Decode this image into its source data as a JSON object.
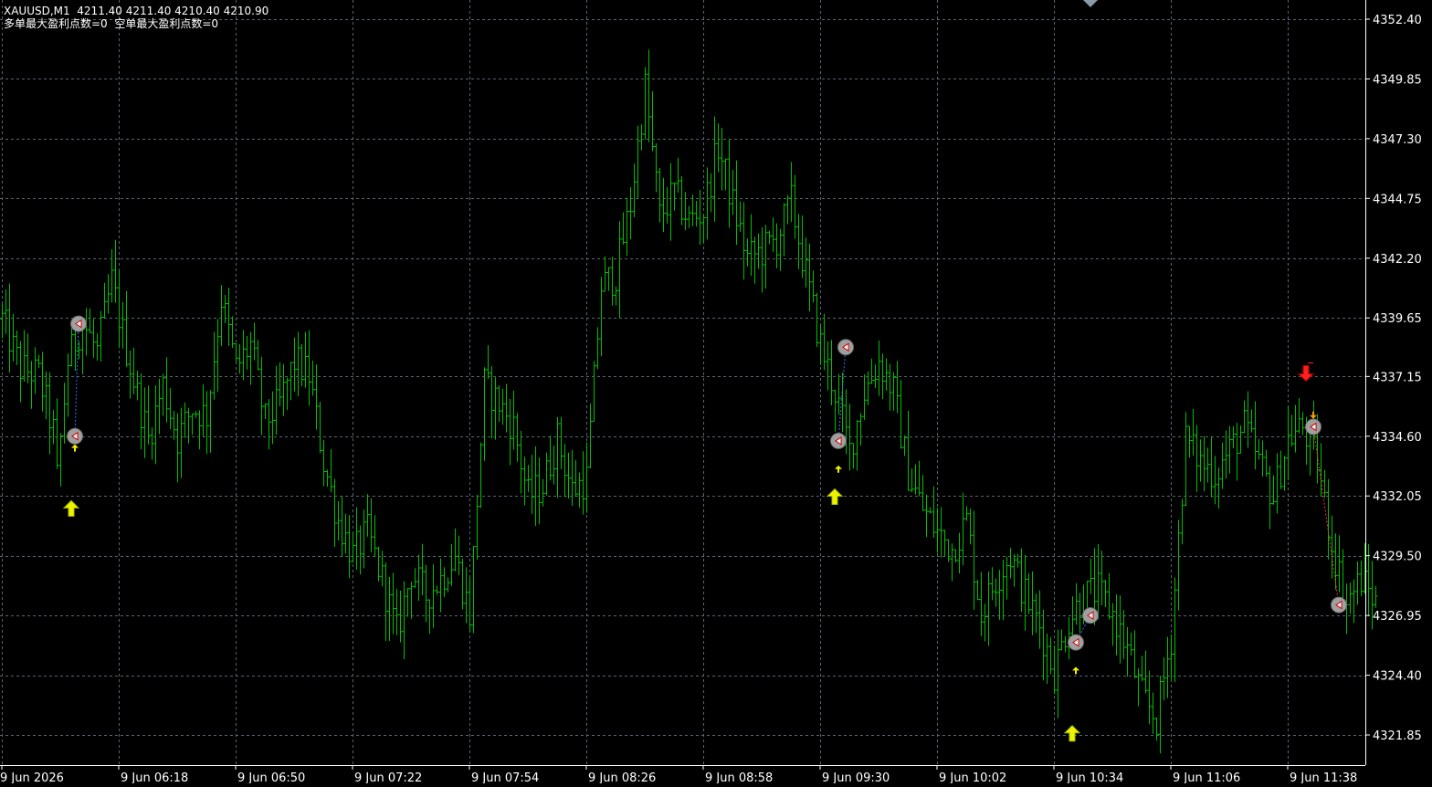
{
  "header": {
    "symbol_line": "XAUUSD,M1  4211.40 4211.40 4210.40 4210.90",
    "stats_line": "多单最大盈利点数=0  空单最大盈利点数=0"
  },
  "colors": {
    "background": "#000000",
    "grid": "#5a6473",
    "axis": "#ffffff",
    "bar": "#00c000",
    "buy_arrow": "#f0f000",
    "sell_arrow": "#ff2020",
    "marker_ring": "#a0a0a0",
    "trade_line_buy": "#1e78ff",
    "trade_line_sell": "#ff3030"
  },
  "chart_data": {
    "type": "bar",
    "symbol": "XAUUSD",
    "timeframe": "M1",
    "ylim": [
      4320.4,
      4353.35
    ],
    "y_ticks": [
      "4352.40",
      "4349.85",
      "4347.30",
      "4344.75",
      "4342.20",
      "4339.65",
      "4337.15",
      "4334.60",
      "4332.05",
      "4329.50",
      "4326.95",
      "4324.40",
      "4321.85"
    ],
    "x_ticks": [
      "9 Jun 2026",
      "9 Jun 06:18",
      "9 Jun 06:50",
      "9 Jun 07:22",
      "9 Jun 07:54",
      "9 Jun 08:26",
      "9 Jun 08:58",
      "9 Jun 09:30",
      "9 Jun 10:02",
      "9 Jun 10:34",
      "9 Jun 11:06",
      "9 Jun 11:38"
    ],
    "bars_per_x_tick": 32,
    "price_path": [
      [
        0,
        4339.6
      ],
      [
        5,
        4337.5
      ],
      [
        10,
        4337.2
      ],
      [
        14,
        4334.8
      ],
      [
        15,
        4332.8
      ],
      [
        18,
        4337.8
      ],
      [
        22,
        4339.5
      ],
      [
        26,
        4338.2
      ],
      [
        30,
        4341.2
      ],
      [
        33,
        4339.0
      ],
      [
        36,
        4337.0
      ],
      [
        40,
        4334.5
      ],
      [
        44,
        4336.8
      ],
      [
        48,
        4334.5
      ],
      [
        52,
        4335.8
      ],
      [
        56,
        4335.5
      ],
      [
        60,
        4340.5
      ],
      [
        64,
        4337.5
      ],
      [
        68,
        4338.5
      ],
      [
        72,
        4335.2
      ],
      [
        76,
        4336.0
      ],
      [
        80,
        4337.8
      ],
      [
        84,
        4337.2
      ],
      [
        88,
        4333.5
      ],
      [
        92,
        4331.0
      ],
      [
        96,
        4329.5
      ],
      [
        100,
        4330.5
      ],
      [
        104,
        4328.5
      ],
      [
        108,
        4326.2
      ],
      [
        112,
        4328.8
      ],
      [
        116,
        4327.8
      ],
      [
        120,
        4328.5
      ],
      [
        124,
        4329.5
      ],
      [
        128,
        4327.0
      ],
      [
        132,
        4336.8
      ],
      [
        136,
        4336.0
      ],
      [
        140,
        4335.0
      ],
      [
        144,
        4332.0
      ],
      [
        148,
        4332.5
      ],
      [
        152,
        4334.5
      ],
      [
        156,
        4332.3
      ],
      [
        160,
        4332.8
      ],
      [
        164,
        4341.0
      ],
      [
        168,
        4341.5
      ],
      [
        172,
        4344.5
      ],
      [
        176,
        4349.5
      ],
      [
        180,
        4344.0
      ],
      [
        184,
        4345.0
      ],
      [
        188,
        4343.8
      ],
      [
        192,
        4344.2
      ],
      [
        196,
        4347.0
      ],
      [
        200,
        4344.5
      ],
      [
        204,
        4342.2
      ],
      [
        208,
        4342.5
      ],
      [
        212,
        4343.0
      ],
      [
        216,
        4344.6
      ],
      [
        220,
        4341.5
      ],
      [
        224,
        4338.5
      ],
      [
        228,
        4336.5
      ],
      [
        232,
        4334.0
      ],
      [
        236,
        4336.5
      ],
      [
        240,
        4337.8
      ],
      [
        244,
        4336.5
      ],
      [
        248,
        4333.0
      ],
      [
        252,
        4331.5
      ],
      [
        256,
        4330.5
      ],
      [
        260,
        4329.8
      ],
      [
        264,
        4331.0
      ],
      [
        268,
        4327.0
      ],
      [
        272,
        4328.5
      ],
      [
        276,
        4329.5
      ],
      [
        280,
        4327.8
      ],
      [
        284,
        4326.5
      ],
      [
        288,
        4324.5
      ],
      [
        292,
        4326.8
      ],
      [
        296,
        4327.8
      ],
      [
        300,
        4328.0
      ],
      [
        304,
        4327.0
      ],
      [
        308,
        4325.5
      ],
      [
        312,
        4323.5
      ],
      [
        316,
        4322.5
      ],
      [
        320,
        4326.0
      ],
      [
        324,
        4334.5
      ],
      [
        328,
        4333.5
      ],
      [
        332,
        4333.0
      ],
      [
        336,
        4334.0
      ],
      [
        340,
        4335.0
      ],
      [
        344,
        4333.5
      ],
      [
        348,
        4332.0
      ],
      [
        352,
        4334.5
      ],
      [
        356,
        4335.0
      ],
      [
        360,
        4333.5
      ],
      [
        364,
        4330.0
      ],
      [
        368,
        4327.5
      ],
      [
        372,
        4328.5
      ],
      [
        376,
        4327.5
      ]
    ],
    "signals": [
      {
        "type": "buy-arrow",
        "bar": 19,
        "price": 4331.5
      },
      {
        "type": "buy-arrow",
        "bar": 228,
        "price": 4332.0
      },
      {
        "type": "buy-arrow",
        "bar": 293,
        "price": 4321.9
      },
      {
        "type": "sell-arrow",
        "bar": 357,
        "price": 4337.3
      }
    ],
    "small_arrows": [
      {
        "type": "buy",
        "bar": 20,
        "price": 4334.1
      },
      {
        "type": "buy",
        "bar": 229,
        "price": 4333.2
      },
      {
        "type": "buy",
        "bar": 294,
        "price": 4324.6
      },
      {
        "type": "sell",
        "bar": 359,
        "price": 4335.5
      }
    ],
    "trades": [
      {
        "side": "buy",
        "open_bar": 20,
        "open_price": 4334.6,
        "close_bar": 21,
        "close_price": 4339.4
      },
      {
        "side": "buy",
        "open_bar": 229,
        "open_price": 4334.4,
        "close_bar": 231,
        "close_price": 4338.4
      },
      {
        "side": "buy",
        "open_bar": 294,
        "open_price": 4325.8,
        "close_bar": 298,
        "close_price": 4326.95
      },
      {
        "side": "sell",
        "open_bar": 359,
        "open_price": 4335.0,
        "close_bar": 366,
        "close_price": 4327.4
      }
    ]
  }
}
